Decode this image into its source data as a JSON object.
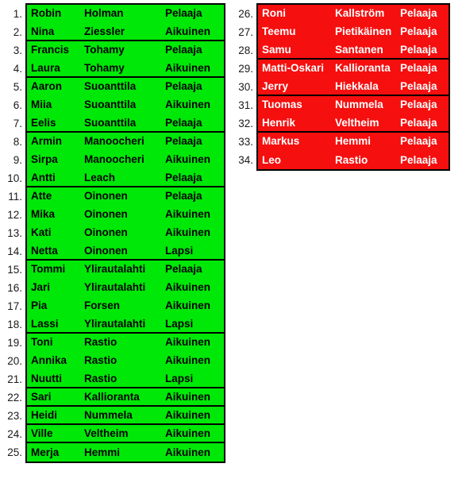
{
  "colors": {
    "green_fill": "#00e807",
    "red_fill": "#f50f0f",
    "border": "#000000",
    "green_text": "#000000",
    "red_text": "#ffffff",
    "index_text": "#1a1a1a",
    "page_background": "#ffffff"
  },
  "left_table": {
    "fill": "#00e807",
    "text_color": "#000000",
    "rows": [
      {
        "index": "1.",
        "first_name": "Robin",
        "last_name": "Holman",
        "role": "Pelaaja",
        "group_end": false
      },
      {
        "index": "2.",
        "first_name": "Nina",
        "last_name": "Ziessler",
        "role": "Aikuinen",
        "group_end": true
      },
      {
        "index": "3.",
        "first_name": "Francis",
        "last_name": "Tohamy",
        "role": "Pelaaja",
        "group_end": false
      },
      {
        "index": "4.",
        "first_name": "Laura",
        "last_name": "Tohamy",
        "role": "Aikuinen",
        "group_end": true
      },
      {
        "index": "5.",
        "first_name": "Aaron",
        "last_name": "Suoanttila",
        "role": "Pelaaja",
        "group_end": false
      },
      {
        "index": "6.",
        "first_name": "Miia",
        "last_name": "Suoanttila",
        "role": "Aikuinen",
        "group_end": false
      },
      {
        "index": "7.",
        "first_name": "Eelis",
        "last_name": "Suoanttila",
        "role": "Pelaaja",
        "group_end": true
      },
      {
        "index": "8.",
        "first_name": "Armin",
        "last_name": "Manoocheri",
        "role": "Pelaaja",
        "group_end": false
      },
      {
        "index": "9.",
        "first_name": "Sirpa",
        "last_name": "Manoocheri",
        "role": "Aikuinen",
        "group_end": false
      },
      {
        "index": "10.",
        "first_name": "Antti",
        "last_name": "Leach",
        "role": "Pelaaja",
        "group_end": true
      },
      {
        "index": "11.",
        "first_name": "Atte",
        "last_name": "Oinonen",
        "role": "Pelaaja",
        "group_end": false
      },
      {
        "index": "12.",
        "first_name": "Mika",
        "last_name": "Oinonen",
        "role": "Aikuinen",
        "group_end": false
      },
      {
        "index": "13.",
        "first_name": "Kati",
        "last_name": "Oinonen",
        "role": "Aikuinen",
        "group_end": false
      },
      {
        "index": "14.",
        "first_name": "Netta",
        "last_name": "Oinonen",
        "role": "Lapsi",
        "group_end": true
      },
      {
        "index": "15.",
        "first_name": "Tommi",
        "last_name": "Ylirautalahti",
        "role": "Pelaaja",
        "group_end": false
      },
      {
        "index": "16.",
        "first_name": "Jari",
        "last_name": "Ylirautalahti",
        "role": "Aikuinen",
        "group_end": false
      },
      {
        "index": "17.",
        "first_name": "Pia",
        "last_name": "Forsen",
        "role": "Aikuinen",
        "group_end": false
      },
      {
        "index": "18.",
        "first_name": "Lassi",
        "last_name": "Ylirautalahti",
        "role": "Lapsi",
        "group_end": true
      },
      {
        "index": "19.",
        "first_name": "Toni",
        "last_name": "Rastio",
        "role": "Aikuinen",
        "group_end": false
      },
      {
        "index": "20.",
        "first_name": "Annika",
        "last_name": "Rastio",
        "role": "Aikuinen",
        "group_end": false
      },
      {
        "index": "21.",
        "first_name": "Nuutti",
        "last_name": "Rastio",
        "role": "Lapsi",
        "group_end": true
      },
      {
        "index": "22.",
        "first_name": "Sari",
        "last_name": "Kallioranta",
        "role": "Aikuinen",
        "group_end": true
      },
      {
        "index": "23.",
        "first_name": "Heidi",
        "last_name": "Nummela",
        "role": "Aikuinen",
        "group_end": true
      },
      {
        "index": "24.",
        "first_name": "Ville",
        "last_name": "Veltheim",
        "role": "Aikuinen",
        "group_end": true
      },
      {
        "index": "25.",
        "first_name": "Merja",
        "last_name": "Hemmi",
        "role": "Aikuinen",
        "group_end": false
      }
    ]
  },
  "right_table": {
    "fill": "#f50f0f",
    "text_color": "#ffffff",
    "rows": [
      {
        "index": "26.",
        "first_name": "Roni",
        "last_name": "Kallström",
        "role": "Pelaaja",
        "group_end": false
      },
      {
        "index": "27.",
        "first_name": "Teemu",
        "last_name": "Pietikäinen",
        "role": "Pelaaja",
        "group_end": false
      },
      {
        "index": "28.",
        "first_name": "Samu",
        "last_name": "Santanen",
        "role": "Pelaaja",
        "group_end": true
      },
      {
        "index": "29.",
        "first_name": "Matti-Oskari",
        "last_name": "Kallioranta",
        "role": "Pelaaja",
        "group_end": false
      },
      {
        "index": "30.",
        "first_name": "Jerry",
        "last_name": "Hiekkala",
        "role": "Pelaaja",
        "group_end": true
      },
      {
        "index": "31.",
        "first_name": "Tuomas",
        "last_name": "Nummela",
        "role": "Pelaaja",
        "group_end": false
      },
      {
        "index": "32.",
        "first_name": "Henrik",
        "last_name": "Veltheim",
        "role": "Pelaaja",
        "group_end": true
      },
      {
        "index": "33.",
        "first_name": "Markus",
        "last_name": "Hemmi",
        "role": "Pelaaja",
        "group_end": false
      },
      {
        "index": "34.",
        "first_name": "Leo",
        "last_name": "Rastio",
        "role": "Pelaaja",
        "group_end": false
      }
    ]
  }
}
